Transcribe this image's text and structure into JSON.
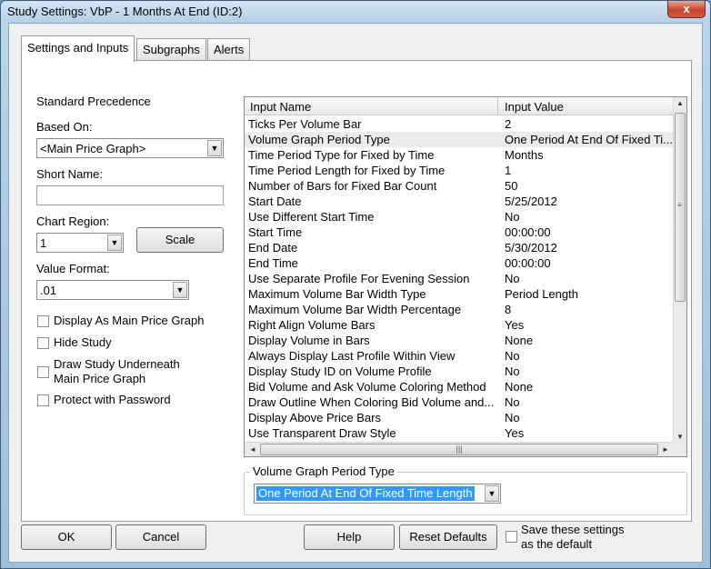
{
  "window": {
    "title": "Study Settings: VbP - 1 Months At End (ID:2)",
    "close_glyph": "x"
  },
  "tabs": [
    "Settings and Inputs",
    "Subgraphs",
    "Alerts"
  ],
  "left": {
    "precedence_label": "Standard Precedence",
    "based_on_label": "Based On:",
    "based_on_value": "<Main Price Graph>",
    "short_name_label": "Short Name:",
    "short_name_value": "",
    "chart_region_label": "Chart Region:",
    "chart_region_value": "1",
    "scale_button": "Scale",
    "value_format_label": "Value Format:",
    "value_format_value": ".01",
    "checkboxes": [
      {
        "label": "Display As Main Price Graph",
        "checked": false
      },
      {
        "label": "Hide Study",
        "checked": false
      },
      {
        "label": "Draw Study Underneath",
        "label2": "Main Price Graph",
        "checked": false
      },
      {
        "label": "Protect with Password",
        "checked": false
      }
    ]
  },
  "grid": {
    "columns": [
      "Input Name",
      "Input Value"
    ],
    "selected_row": 1,
    "rows": [
      [
        "Ticks Per Volume Bar",
        "2"
      ],
      [
        "Volume Graph Period Type",
        "One Period At End Of Fixed Ti..."
      ],
      [
        "Time Period Type for Fixed by Time",
        "Months"
      ],
      [
        "Time Period Length for Fixed by Time",
        "1"
      ],
      [
        "Number of Bars for Fixed Bar Count",
        "50"
      ],
      [
        "Start Date",
        "5/25/2012"
      ],
      [
        "Use Different Start Time",
        "No"
      ],
      [
        "Start Time",
        "00:00:00"
      ],
      [
        "End Date",
        "5/30/2012"
      ],
      [
        "End Time",
        "00:00:00"
      ],
      [
        "Use Separate Profile For Evening Session",
        "No"
      ],
      [
        "Maximum Volume Bar Width Type",
        "Period Length"
      ],
      [
        "Maximum Volume Bar Width Percentage",
        "8"
      ],
      [
        "Right Align Volume Bars",
        "Yes"
      ],
      [
        "Display Volume in Bars",
        "None"
      ],
      [
        "Always Display Last Profile Within View",
        "No"
      ],
      [
        "Display Study ID on Volume Profile",
        "No"
      ],
      [
        "Bid Volume and Ask Volume Coloring Method",
        "None"
      ],
      [
        "Draw Outline When Coloring Bid Volume and...",
        "No"
      ],
      [
        "Display Above Price Bars",
        "No"
      ],
      [
        "Use Transparent Draw Style",
        "Yes"
      ]
    ]
  },
  "editor": {
    "group_title": "Volume Graph Period Type",
    "value": "One Period At End Of Fixed Time Length"
  },
  "footer": {
    "ok": "OK",
    "cancel": "Cancel",
    "help": "Help",
    "reset": "Reset Defaults",
    "save_line1": "Save these settings",
    "save_line2": "as the default"
  },
  "icons": {
    "dropdown": "chevron-down-icon",
    "scroll_up": "scroll-up-icon",
    "scroll_down": "scroll-down-icon",
    "scroll_left": "scroll-left-icon",
    "scroll_right": "scroll-right-icon",
    "grip": "grip-icon"
  },
  "colors": {
    "selection": "#3399ff",
    "close_button": "#c7432c"
  }
}
